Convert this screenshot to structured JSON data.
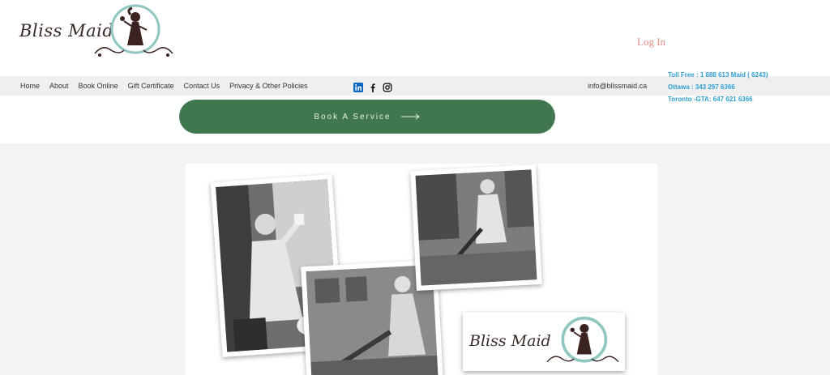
{
  "brand": {
    "name": "Bliss Maid"
  },
  "header": {
    "login_label": "Log In"
  },
  "nav": {
    "items": [
      {
        "label": "Home"
      },
      {
        "label": "About"
      },
      {
        "label": "Book Online"
      },
      {
        "label": "Gift Certificate"
      },
      {
        "label": "Contact Us"
      },
      {
        "label": "Privacy & Other Policies"
      }
    ]
  },
  "social": {
    "icons": [
      "linkedin-icon",
      "facebook-icon",
      "instagram-icon"
    ]
  },
  "contact": {
    "email": "info@blissmaid.ca",
    "phones": [
      "Toll Free : 1 888 613 Maid ( 6243)",
      "Ottawa : 343 297 6366",
      "Toronto -GTA: 647 621 6366"
    ]
  },
  "cta": {
    "label": "Book A Service"
  },
  "colors": {
    "accent_green": "#3f774f",
    "login_pink": "#e88a86",
    "phone_blue": "#2f9fcf",
    "logo_teal": "#8fc6c0"
  },
  "collage": {
    "logo_text": "Bliss Maid"
  }
}
